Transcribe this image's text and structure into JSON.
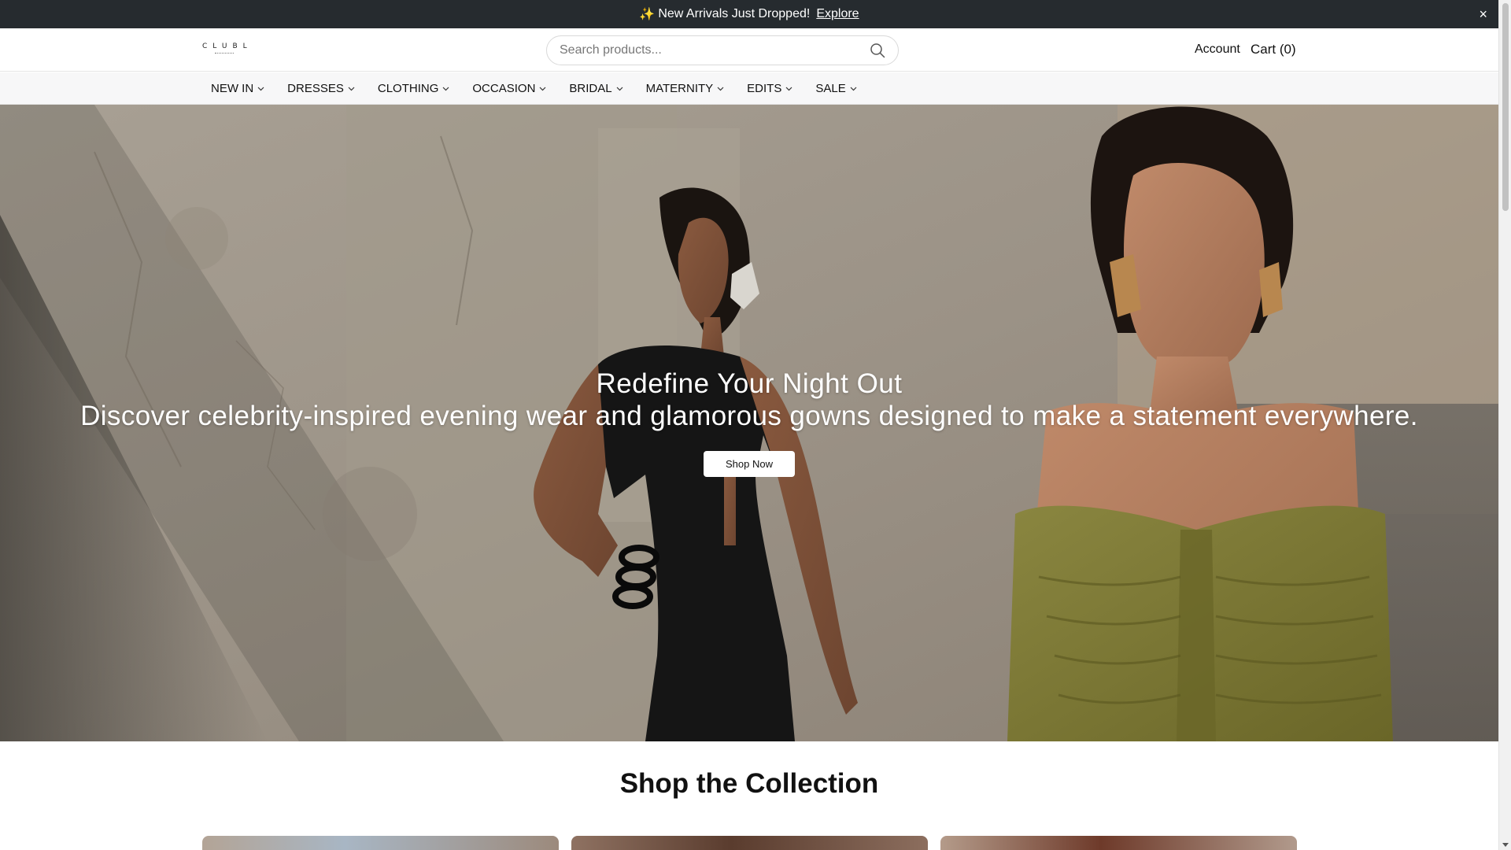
{
  "announcement": {
    "sparkle": "✨",
    "text": "New Arrivals Just Dropped!",
    "link_label": "Explore",
    "close_label": "×"
  },
  "header": {
    "logo": "CLUBL",
    "search_placeholder": "Search products...",
    "account_label": "Account",
    "cart_label": "Cart (0)"
  },
  "nav": {
    "items": [
      {
        "label": "NEW IN"
      },
      {
        "label": "DRESSES"
      },
      {
        "label": "CLOTHING"
      },
      {
        "label": "OCCASION"
      },
      {
        "label": "BRIDAL"
      },
      {
        "label": "MATERNITY"
      },
      {
        "label": "EDITS"
      },
      {
        "label": "SALE"
      }
    ]
  },
  "hero": {
    "title": "Redefine Your Night Out",
    "subtitle": "Discover celebrity-inspired evening wear and glamorous gowns designed to make a statement everywhere.",
    "cta_label": "Shop Now"
  },
  "collection": {
    "title": "Shop the Collection"
  },
  "colors": {
    "announcement_bg": "#262b2f",
    "nav_bg": "#f7f7f8",
    "hero_wall": "#9a9184",
    "black_dress": "#151515",
    "olive_dress": "#7d7a35"
  }
}
